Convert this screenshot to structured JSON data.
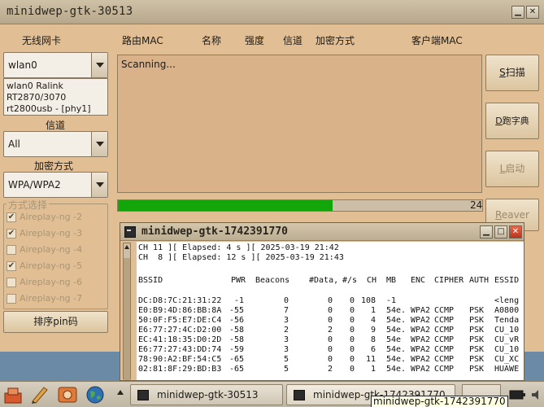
{
  "window": {
    "title": "minidwep-gtk-30513"
  },
  "labels": {
    "wireless_card": "无线网卡",
    "channel": "信道",
    "encryption": "加密方式",
    "method": "方式选择"
  },
  "columns": [
    "路由MAC",
    "名称",
    "强度",
    "信道",
    "加密方式",
    "客户端MAC"
  ],
  "interface": {
    "value": "wlan0",
    "info": [
      "wlan0 Ralink",
      "RT2870/3070",
      "rt2800usb - [phy1]"
    ]
  },
  "channel_value": "All",
  "encryption_value": "WPA/WPA2",
  "methods": [
    {
      "label": "Aireplay-ng -2",
      "checked": true
    },
    {
      "label": "Aireplay-ng -3",
      "checked": true
    },
    {
      "label": "Aireplay-ng -4",
      "checked": false
    },
    {
      "label": "Aireplay-ng -5",
      "checked": true
    },
    {
      "label": "Aireplay-ng -6",
      "checked": false
    },
    {
      "label": "Aireplay-ng -7",
      "checked": false
    }
  ],
  "pin_button": "排序pin码",
  "list_status": "Scanning...",
  "progress": {
    "value": 0.59,
    "label": "24"
  },
  "side_buttons": {
    "scan": {
      "key": "S",
      "rest": "扫描"
    },
    "dict": {
      "key": "D",
      "rest": "跑字典"
    },
    "start": {
      "key": "L",
      "rest": "启动"
    },
    "reaver": {
      "key": "R",
      "rest": "eaver"
    }
  },
  "terminal": {
    "title": "minidwep-gtk-1742391770",
    "lines": [
      "CH 11 ][ Elapsed: 4 s ][ 2025-03-19 21:42",
      "CH  8 ][ Elapsed: 12 s ][ 2025-03-19 21:43"
    ],
    "headers": [
      "BSSID",
      "PWR",
      "Beacons",
      "#Data,",
      "#/s",
      "CH",
      "MB",
      "ENC",
      "CIPHER",
      "AUTH",
      "ESSID"
    ],
    "rows": [
      [
        "DC:D8:7C:21:31:22",
        "-1",
        "0",
        "0",
        "0",
        "108",
        "-1",
        "",
        "",
        "",
        "<leng"
      ],
      [
        "E0:B9:4D:86:BB:8A",
        "-55",
        "7",
        "0",
        "0",
        "1",
        "54e.",
        "WPA2",
        "CCMP",
        "PSK",
        "A0800"
      ],
      [
        "50:0F:F5:E7:DE:C4",
        "-56",
        "3",
        "0",
        "0",
        "4",
        "54e.",
        "WPA2",
        "CCMP",
        "PSK",
        "Tenda"
      ],
      [
        "E6:77:27:4C:D2:00",
        "-58",
        "2",
        "2",
        "0",
        "9",
        "54e.",
        "WPA2",
        "CCMP",
        "PSK",
        "CU_10"
      ],
      [
        "EC:41:18:35:D0:2D",
        "-58",
        "3",
        "0",
        "0",
        "8",
        "54e",
        "WPA2",
        "CCMP",
        "PSK",
        "CU_vR"
      ],
      [
        "E6:77:27:43:DD:74",
        "-59",
        "3",
        "0",
        "0",
        "6",
        "54e.",
        "WPA2",
        "CCMP",
        "PSK",
        "CU_10"
      ],
      [
        "78:90:A2:BF:54:C5",
        "-65",
        "5",
        "0",
        "0",
        "11",
        "54e.",
        "WPA2",
        "CCMP",
        "PSK",
        "CU_XC"
      ],
      [
        "02:81:8F:29:BD:B3",
        "-65",
        "5",
        "2",
        "0",
        "1",
        "54e.",
        "WPA2",
        "CCMP",
        "PSK",
        "HUAWE"
      ]
    ]
  },
  "taskbar": {
    "task1": "minidwep-gtk-30513",
    "task2": "minidwep-gtk-1742391770",
    "tooltip": "minidwep-gtk-1742391770"
  }
}
